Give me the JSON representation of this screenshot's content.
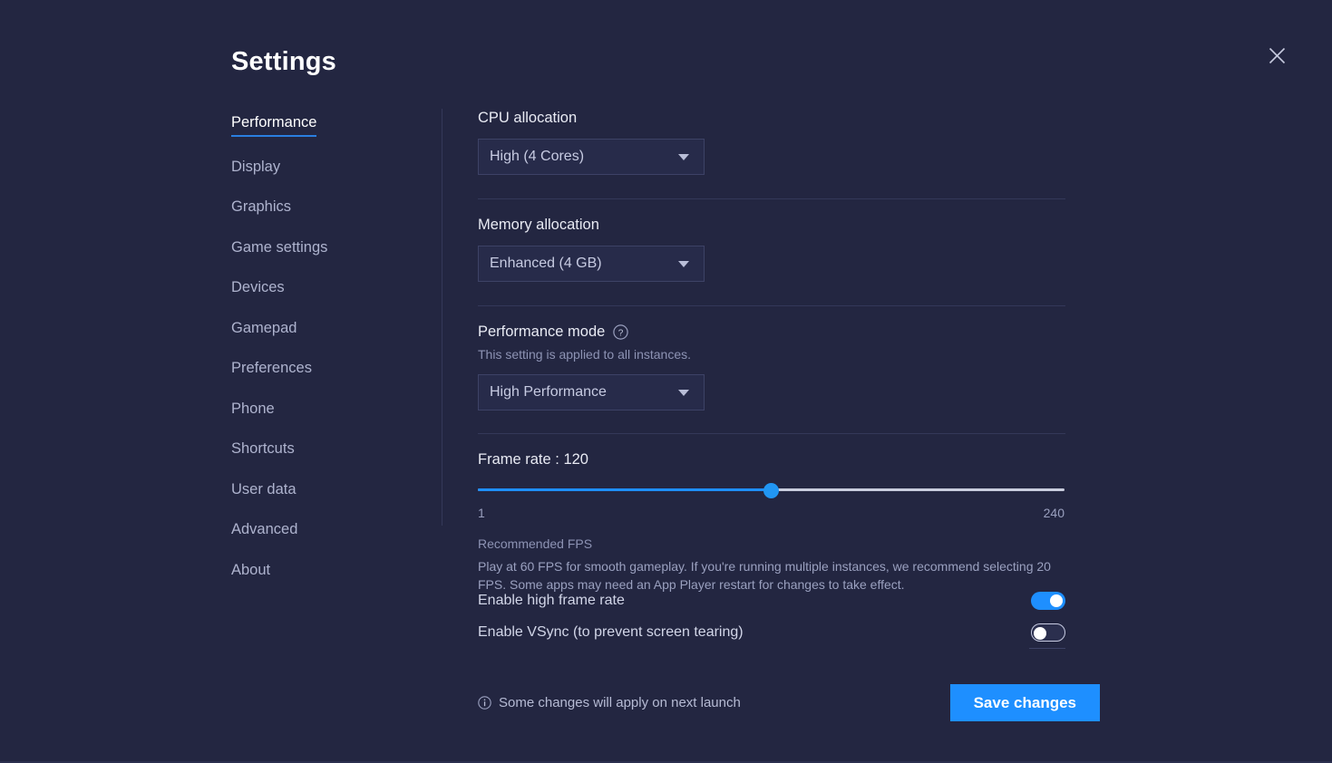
{
  "window": {
    "title": "Settings",
    "close_icon": "close-icon"
  },
  "sidebar": {
    "items": [
      {
        "label": "Performance",
        "active": true
      },
      {
        "label": "Display",
        "active": false
      },
      {
        "label": "Graphics",
        "active": false
      },
      {
        "label": "Game settings",
        "active": false
      },
      {
        "label": "Devices",
        "active": false
      },
      {
        "label": "Gamepad",
        "active": false
      },
      {
        "label": "Preferences",
        "active": false
      },
      {
        "label": "Phone",
        "active": false
      },
      {
        "label": "Shortcuts",
        "active": false
      },
      {
        "label": "User data",
        "active": false
      },
      {
        "label": "Advanced",
        "active": false
      },
      {
        "label": "About",
        "active": false
      }
    ]
  },
  "cpu": {
    "label": "CPU allocation",
    "value": "High (4 Cores)"
  },
  "memory": {
    "label": "Memory allocation",
    "value": "Enhanced (4 GB)"
  },
  "performance_mode": {
    "label": "Performance mode",
    "help_icon": "help-circle-icon",
    "description": "This setting is applied to all instances.",
    "value": "High Performance"
  },
  "frame_rate": {
    "label": "Frame rate : 120",
    "value": 120,
    "min_label": "1",
    "max_label": "240",
    "min": 1,
    "max": 240,
    "recommended_title": "Recommended FPS",
    "recommended_body": "Play at 60 FPS for smooth gameplay. If you're running multiple instances, we recommend selecting 20 FPS. Some apps may need an App Player restart for changes to take effect."
  },
  "toggles": [
    {
      "label": "Enable high frame rate",
      "state": "on"
    },
    {
      "label": "Enable VSync (to prevent screen tearing)",
      "state": "off"
    }
  ],
  "footer": {
    "info_icon": "info-circle-icon",
    "note": "Some changes will apply on next launch",
    "save_label": "Save changes"
  },
  "colors": {
    "background": "#232641",
    "accent": "#1e8fff",
    "accent_underline": "#2a7fe0",
    "text_primary": "#ffffff",
    "text_secondary": "#aeb3ce",
    "text_muted": "#8d93b4",
    "field_background": "#272b4a",
    "divider": "#343859"
  }
}
